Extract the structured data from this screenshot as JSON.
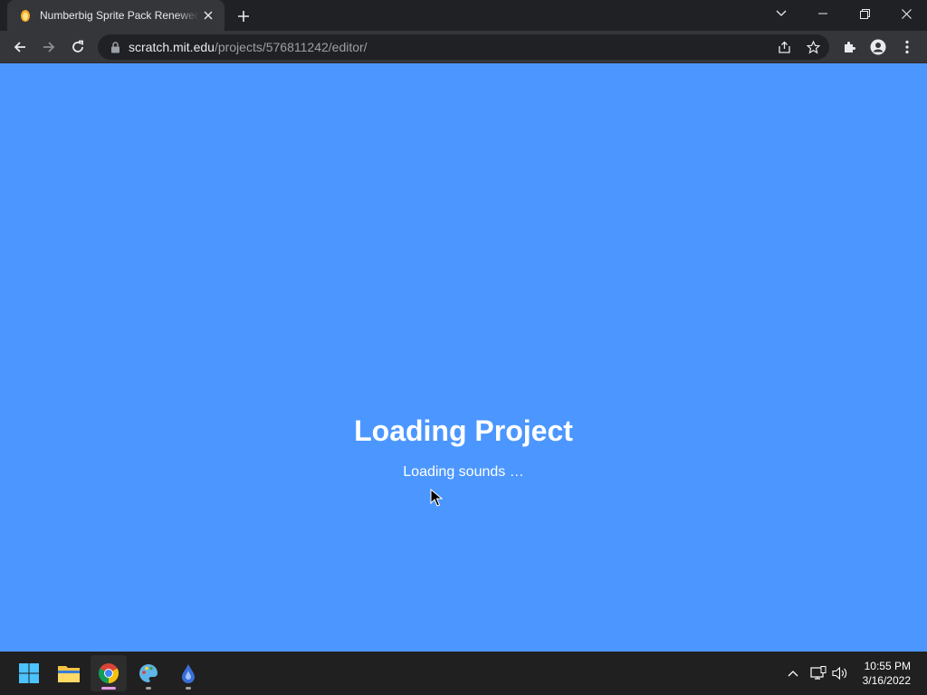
{
  "browser": {
    "tab": {
      "title": "Numberbig Sprite Pack Renewed",
      "favicon": "scratch-cat-icon"
    },
    "url": {
      "host": "scratch.mit.edu",
      "path": "/projects/576811242/editor/"
    }
  },
  "page": {
    "background": "#4c97ff",
    "loading_title": "Loading Project",
    "loading_status": "Loading sounds …"
  },
  "taskbar": {
    "apps": [
      "windows-start",
      "file-explorer",
      "google-chrome",
      "paint",
      "edge-dev"
    ],
    "clock": {
      "time": "10:55 PM",
      "date": "3/16/2022"
    }
  }
}
